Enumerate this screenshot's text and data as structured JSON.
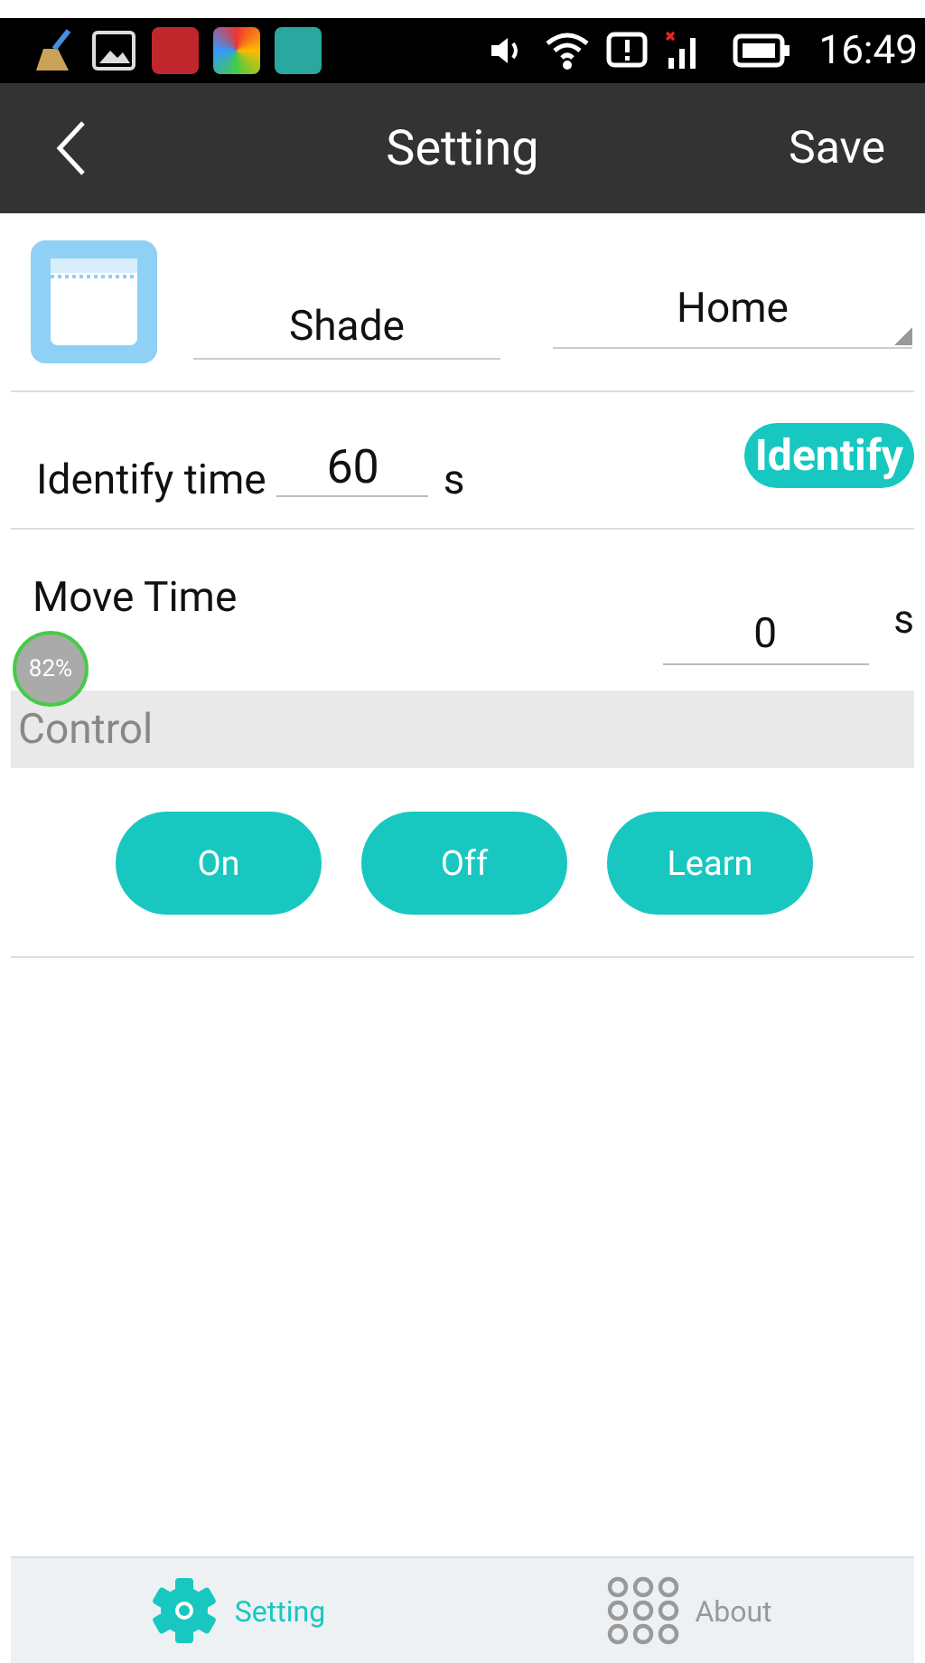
{
  "status_bar": {
    "time": "16:49"
  },
  "app_bar": {
    "title": "Setting",
    "action": "Save"
  },
  "device": {
    "name": "Shade",
    "room": "Home"
  },
  "identify": {
    "label": "Identify time",
    "value": "60",
    "unit": "s",
    "button": "Identify"
  },
  "move_time": {
    "label": "Move Time",
    "value": "0",
    "unit": "s"
  },
  "overlay_badge": "82%",
  "control": {
    "heading": "Control",
    "buttons": [
      "On",
      "Off",
      "Learn"
    ]
  },
  "bottom_tabs": [
    {
      "label": "Setting",
      "selected": true
    },
    {
      "label": "About",
      "selected": false
    }
  ]
}
